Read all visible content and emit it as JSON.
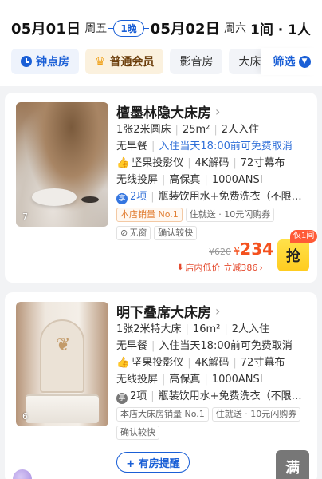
{
  "header": {
    "checkin_date": "05月01日",
    "checkin_dow": "周五",
    "nights": "1晚",
    "checkout_date": "05月02日",
    "checkout_dow": "周六",
    "rooms_guests": "1间 · 1人"
  },
  "filters": {
    "items": [
      {
        "label": "钟点房",
        "icon": "clock-icon"
      },
      {
        "label": "普通会员",
        "icon": "crown-icon"
      },
      {
        "label": "影音房"
      },
      {
        "label": "大床"
      }
    ],
    "filter_label": "筛选",
    "filter_icon": "chevron-down-icon"
  },
  "rooms": [
    {
      "name": "檀墨林隐大床房",
      "photo_count": "7",
      "specs": [
        "1张2米圆床",
        "25m²",
        "2人入住"
      ],
      "meal": "无早餐",
      "cancel": "入住当天18:00前可免费取消",
      "features_a": [
        "坚果投影仪",
        "4K解码",
        "72寸幕布"
      ],
      "features_b": [
        "无线投屏",
        "高保真",
        "1000ANSI"
      ],
      "amenity_count": "2项",
      "amenities": "瓶装饮用水+免费洗衣（不限…",
      "tag_sales": "本店销量 No.1",
      "tag_extra": "住就送 · 10元闪购券",
      "tag_window": "无窗",
      "tag_confirm": "确认较快",
      "old_price": "¥620",
      "currency": "¥",
      "price": "234",
      "discount": "店内低价",
      "discount_amount": "立减386",
      "only_label": "仅1间",
      "action": "抢"
    },
    {
      "name": "明下叠席大床房",
      "photo_count": "6",
      "specs": [
        "1张2米特大床",
        "16m²",
        "2人入住"
      ],
      "meal": "无早餐",
      "cancel": "入住当天18:00前可免费取消",
      "features_a": [
        "坚果投影仪",
        "4K解码",
        "72寸幕布"
      ],
      "features_b": [
        "无线投屏",
        "高保真",
        "1000ANSI"
      ],
      "amenity_count": "2项",
      "amenities": "瓶装饮用水+免费洗衣（不限…",
      "tag_sales": "本店大床房销量 No.1",
      "tag_extra": "住就送 · 10元闪购券",
      "tag_confirm": "确认较快",
      "remind": "+ 有房提醒",
      "full": "满"
    }
  ]
}
